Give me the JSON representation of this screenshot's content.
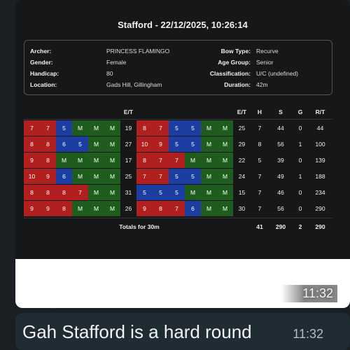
{
  "scorecard": {
    "title": "Stafford - 22/12/2025, 10:26:14",
    "info": {
      "archer_label": "Archer:",
      "archer": "PRINCESS FLAMINGO",
      "gender_label": "Gender:",
      "gender": "Female",
      "handicap_label": "Handicap:",
      "handicap": "80",
      "location_label": "Location:",
      "location": "Gads Hill, Gillingham",
      "bow_type_label": "Bow Type:",
      "bow_type": "Recurve",
      "age_group_label": "Age Group:",
      "age_group": "Senior",
      "classification_label": "Classification:",
      "classification": "U/C (undefined)",
      "duration_label": "Duration:",
      "duration": "42m"
    },
    "headers": [
      "E/T",
      "E/T",
      "H",
      "S",
      "G",
      "R/T"
    ],
    "rows": [
      {
        "a": [
          "7",
          "7",
          "5",
          "M",
          "M",
          "M"
        ],
        "et1": "19",
        "b": [
          "8",
          "7",
          "5",
          "5",
          "M",
          "M"
        ],
        "et2": "25",
        "h": "7",
        "s": "44",
        "g": "0",
        "rt": "44"
      },
      {
        "a": [
          "8",
          "8",
          "6",
          "5",
          "M",
          "M"
        ],
        "et1": "27",
        "b": [
          "10",
          "9",
          "5",
          "5",
          "M",
          "M"
        ],
        "et2": "29",
        "h": "8",
        "s": "56",
        "g": "1",
        "rt": "100"
      },
      {
        "a": [
          "9",
          "8",
          "M",
          "M",
          "M",
          "M"
        ],
        "et1": "17",
        "b": [
          "8",
          "7",
          "7",
          "M",
          "M",
          "M"
        ],
        "et2": "22",
        "h": "5",
        "s": "39",
        "g": "0",
        "rt": "139"
      },
      {
        "a": [
          "10",
          "9",
          "6",
          "M",
          "M",
          "M"
        ],
        "et1": "25",
        "b": [
          "7",
          "7",
          "5",
          "5",
          "M",
          "M"
        ],
        "et2": "24",
        "h": "7",
        "s": "49",
        "g": "1",
        "rt": "188"
      },
      {
        "a": [
          "8",
          "8",
          "8",
          "7",
          "M",
          "M"
        ],
        "et1": "31",
        "b": [
          "5",
          "5",
          "5",
          "M",
          "M",
          "M"
        ],
        "et2": "15",
        "h": "7",
        "s": "46",
        "g": "0",
        "rt": "234"
      },
      {
        "a": [
          "9",
          "9",
          "8",
          "M",
          "M",
          "M"
        ],
        "et1": "26",
        "b": [
          "9",
          "8",
          "7",
          "6",
          "M",
          "M"
        ],
        "et2": "30",
        "h": "7",
        "s": "56",
        "g": "0",
        "rt": "290"
      }
    ],
    "totals_label": "Totals for 30m",
    "totals": {
      "h": "41",
      "s": "290",
      "g": "2",
      "rt": "290"
    },
    "colors": {
      "gold": "#b21f1f",
      "red": "#b21f1f",
      "blue": "#1c3ea3",
      "miss": "#1f5d1f"
    }
  },
  "image_time": "11:32",
  "message": {
    "text": "Gah Stafford is a hard round",
    "time": "11:32"
  }
}
